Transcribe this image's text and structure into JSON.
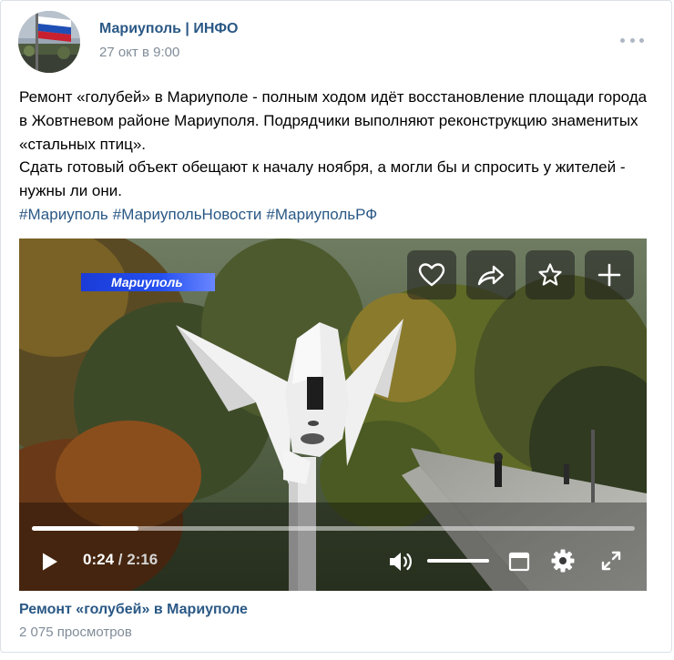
{
  "post": {
    "author": "Мариуполь | ИНФО",
    "date": "27 окт в 9:00",
    "paragraphs": [
      "Ремонт «голубей» в Мариуполе - полным ходом идёт восстановление площади города в Жовтневом районе Мариуполя. Подрядчики выполняют реконструкцию знаменитых «стальных птиц».",
      "Сдать готовый объект обещают к началу ноября, а могли бы и спросить у жителей - нужны ли они."
    ],
    "hashtags": [
      "#Мариуполь",
      "#МариупольНовости",
      "#МариупольРФ"
    ]
  },
  "video": {
    "overlay_caption": "Мариуполь",
    "current_time": "0:24",
    "separator": "/",
    "duration": "2:16",
    "progress_fraction": 0.176,
    "volume_fraction": 1.0,
    "title": "Ремонт «голубей» в Мариуполе",
    "views": "2 075 просмотров"
  },
  "icons": {
    "avatar": "avatar-flag-icon",
    "more": "more-dots-icon",
    "like": "heart-icon",
    "share": "share-arrow-icon",
    "favorite": "star-icon",
    "add": "plus-icon",
    "play": "play-icon",
    "volume": "volume-icon",
    "miniplayer": "miniplayer-icon",
    "settings": "gear-icon",
    "fullscreen": "fullscreen-icon"
  },
  "colors": {
    "link": "#2a5885",
    "secondary_text": "#818c99",
    "caption_bar": "#2550f0"
  }
}
